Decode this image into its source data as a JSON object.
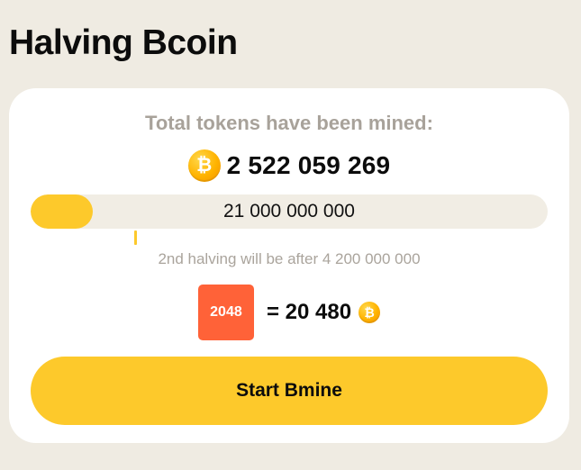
{
  "header": {
    "title": "Halving Bcoin"
  },
  "mined": {
    "label": "Total tokens have been mined:",
    "value": "2 522 059 269",
    "coin_icon": "bitcoin-coin-icon",
    "coin_glyph": "₿"
  },
  "progress": {
    "total_label": "21 000 000 000",
    "fraction": 0.12
  },
  "halving": {
    "note": "2nd halving will be after 4 200 000 000"
  },
  "tile": {
    "label": "2048",
    "equals_text": "= 20 480",
    "coin_glyph": "₿"
  },
  "actions": {
    "start_label": "Start Bmine"
  },
  "colors": {
    "background": "#efebe2",
    "accent": "#fdc92b",
    "tile": "#ff6238",
    "muted_text": "#a8a29a"
  }
}
